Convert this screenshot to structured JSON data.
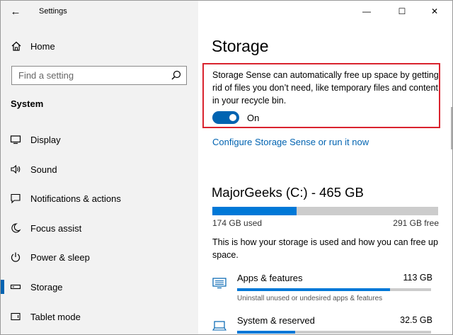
{
  "window": {
    "app_title": "Settings",
    "back_glyph": "←",
    "controls": {
      "minimize": "—",
      "maximize": "☐",
      "close": "✕"
    }
  },
  "sidebar": {
    "home_label": "Home",
    "search_placeholder": "Find a setting",
    "section_title": "System",
    "items": [
      {
        "label": "Display",
        "icon": "monitor-icon",
        "glyph": "🖵"
      },
      {
        "label": "Sound",
        "icon": "speaker-icon",
        "glyph": "🕪"
      },
      {
        "label": "Notifications & actions",
        "icon": "notification-icon",
        "glyph": "🗨"
      },
      {
        "label": "Focus assist",
        "icon": "moon-icon",
        "glyph": "☽"
      },
      {
        "label": "Power & sleep",
        "icon": "power-icon",
        "glyph": "⏻"
      },
      {
        "label": "Storage",
        "icon": "storage-icon",
        "glyph": "▭",
        "selected": true
      },
      {
        "label": "Tablet mode",
        "icon": "tablet-icon",
        "glyph": "▯"
      }
    ]
  },
  "main": {
    "page_title": "Storage",
    "storage_sense": {
      "description": "Storage Sense can automatically free up space by getting rid of files you don’t need, like temporary files and content in your recycle bin.",
      "toggle_on": true,
      "toggle_label": "On"
    },
    "configure_link": "Configure Storage Sense or run it now",
    "drive": {
      "title": "MajorGeeks (C:) - 465 GB",
      "used_label": "174 GB used",
      "free_label": "291 GB free",
      "used_fraction": 0.374
    },
    "usage_description": "This is how your storage is used and how you can free up space.",
    "categories": [
      {
        "name": "Apps & features",
        "size": "113 GB",
        "description": "Uninstall unused or undesired apps & features",
        "fraction": 0.79,
        "icon": "apps-list-icon"
      },
      {
        "name": "System & reserved",
        "size": "32.5 GB",
        "description": "",
        "fraction": 0.3,
        "icon": "laptop-icon"
      }
    ]
  },
  "colors": {
    "accent": "#0078d7",
    "link": "#0063b1",
    "highlight_border": "#d9232e",
    "sidebar_bg": "#f2f2f2",
    "bar_track": "#cccccc"
  }
}
